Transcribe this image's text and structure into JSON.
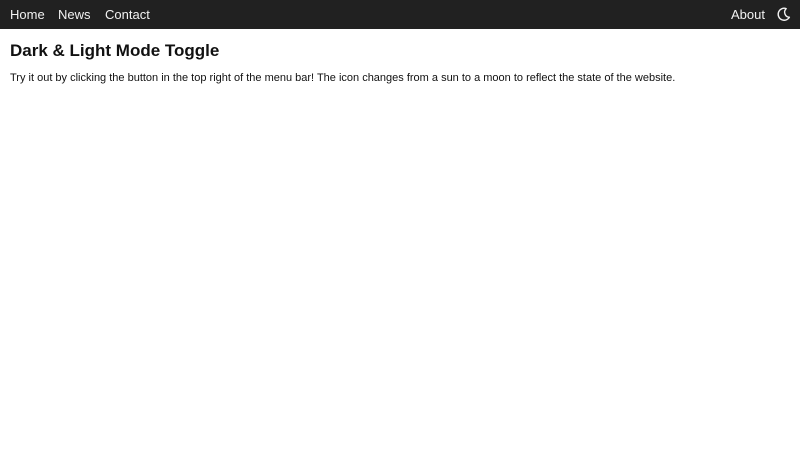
{
  "nav": {
    "home_label": "Home",
    "news_label": "News",
    "contact_label": "Contact",
    "about_label": "About",
    "toggle_icon": "moon-icon",
    "background_color": "#212121",
    "text_color": "#f2f2f2"
  },
  "main": {
    "title": "Dark & Light Mode Toggle",
    "description": "Try it out by clicking the button in the top right of the menu bar! The icon changes from a sun to a moon to reflect the state of the website."
  },
  "theme": {
    "page_background": "#ffffff",
    "text_color": "#111111"
  }
}
